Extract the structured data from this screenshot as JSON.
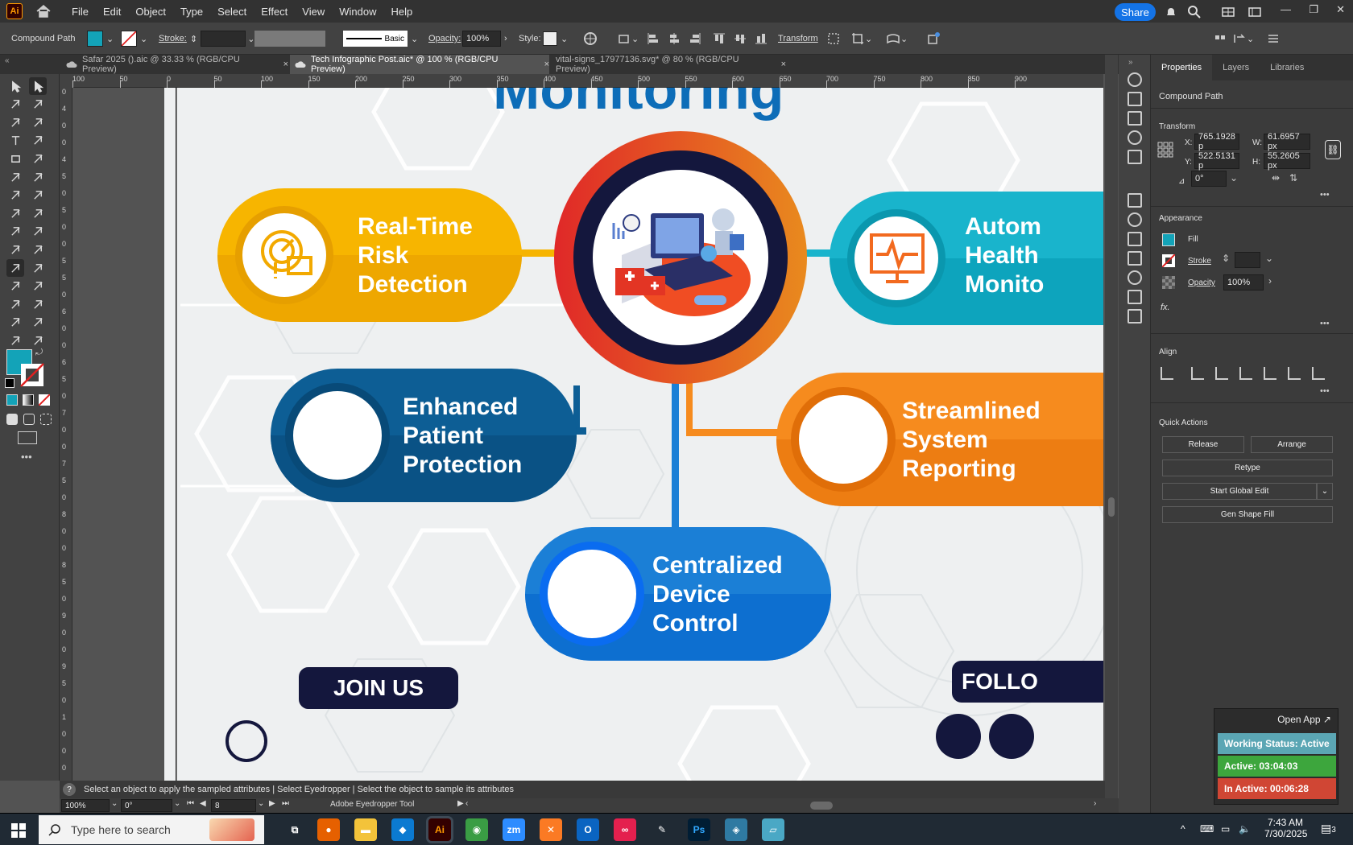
{
  "menubar": {
    "logo": "Ai",
    "items": [
      "File",
      "Edit",
      "Object",
      "Type",
      "Select",
      "Effect",
      "View",
      "Window",
      "Help"
    ],
    "share": "Share"
  },
  "control": {
    "object_type": "Compound Path",
    "stroke_label": "Stroke:",
    "brush": "Basic",
    "opacity_label": "Opacity:",
    "opacity_value": "100%",
    "style_label": "Style:",
    "transform_label": "Transform",
    "fill_color": "#13a3b8"
  },
  "tabs": [
    {
      "label": "Safar 2025 ().aic @ 33.33 % (RGB/CPU Preview)",
      "close": "×"
    },
    {
      "label": "Tech Infographic Post.aic* @ 100 % (RGB/CPU Preview)",
      "close": "×"
    },
    {
      "label": "vital-signs_17977136.svg* @ 80 % (RGB/CPU Preview)",
      "close": "×"
    }
  ],
  "ruler_top": [
    "100",
    "50",
    "0",
    "50",
    "100",
    "150",
    "200",
    "250",
    "300",
    "350",
    "400",
    "450",
    "500",
    "550",
    "600",
    "650",
    "700",
    "750",
    "800",
    "850",
    "900"
  ],
  "ruler_left": [
    "0",
    "4",
    "0",
    "0",
    "4",
    "5",
    "0",
    "5",
    "0",
    "0",
    "5",
    "5",
    "0",
    "6",
    "0",
    "0",
    "6",
    "5",
    "0",
    "7",
    "0",
    "0",
    "7",
    "5",
    "0",
    "8",
    "0",
    "0",
    "8",
    "5",
    "0",
    "9",
    "0",
    "0",
    "9",
    "5",
    "0",
    "1",
    "0",
    "0",
    "0"
  ],
  "panel": {
    "tabs": [
      "Properties",
      "Layers",
      "Libraries"
    ],
    "object": "Compound Path",
    "transform": "Transform",
    "x_label": "X:",
    "x": "765.1928 p",
    "y_label": "Y:",
    "y": "522.5131 p",
    "w_label": "W:",
    "w": "61.6957 px",
    "h_label": "H:",
    "h": "55.2605 px",
    "angle_label": "⊿",
    "angle": "0°",
    "appearance": "Appearance",
    "fill": "Fill",
    "stroke": "Stroke",
    "opacity": "Opacity",
    "opacity_value": "100%",
    "fx": "fx.",
    "align": "Align",
    "quick_actions": "Quick Actions",
    "release": "Release",
    "arrange": "Arrange",
    "retype": "Retype",
    "global_edit": "Start Global Edit",
    "gen_fill": "Gen Shape Fill",
    "more": "•••"
  },
  "artboard": {
    "title_partial": "Monitoring",
    "pills": {
      "real_time": [
        "Real-Time",
        "Risk",
        "Detection"
      ],
      "automated": [
        "Autom",
        "Health",
        "Monito"
      ],
      "enhanced": [
        "Enhanced",
        "Patient",
        "Protection"
      ],
      "streamlined": [
        "Streamlined",
        "System",
        "Reporting"
      ],
      "centralized": [
        "Centralized",
        "Device",
        "Control"
      ]
    },
    "join": "JOIN US",
    "follow": "FOLLO"
  },
  "status": {
    "help": "?",
    "message": "Select an object to apply the sampled attributes  |  Select Eyedropper  |  Select the object to sample its attributes"
  },
  "bottom": {
    "zoom": "100%",
    "rotate": "0°",
    "page": "8",
    "tool": "Adobe Eyedropper Tool"
  },
  "widget": {
    "open_app": "Open App ↗",
    "working": "Working Status: Active",
    "active": "Active: 03:04:03",
    "inactive": "In Active: 00:06:28"
  },
  "taskbar": {
    "search": "Type here to search",
    "time": "7:43 AM",
    "date": "7/30/2025",
    "notif": "3"
  }
}
